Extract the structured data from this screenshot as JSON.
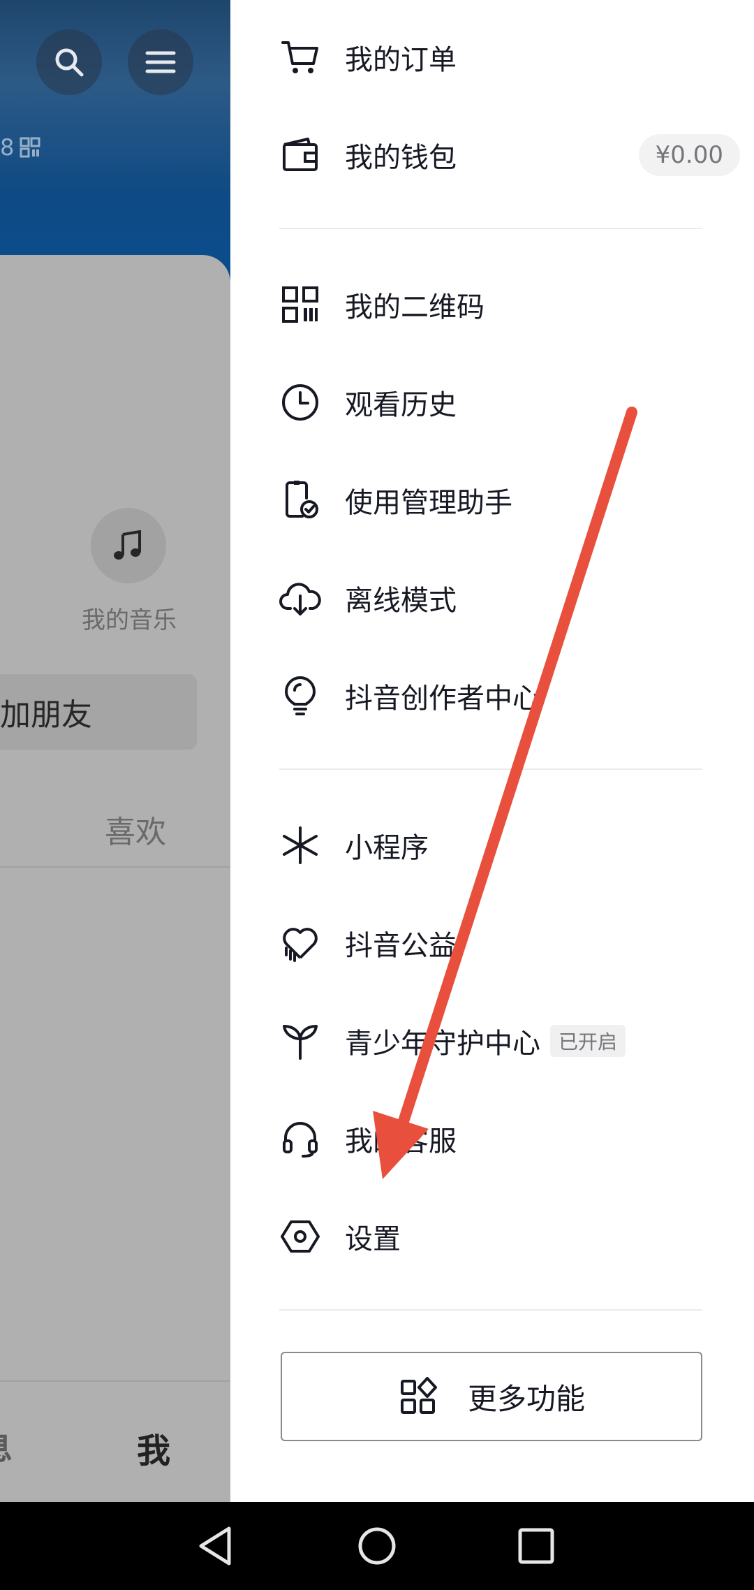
{
  "left_panel": {
    "stats_snippet": "8",
    "music_label": "我的音乐",
    "add_friend_label": "加朋友",
    "like_tab_label": "喜欢",
    "bottom_nav": {
      "messages_label": "息",
      "me_label": "我"
    }
  },
  "drawer": {
    "group1": [
      {
        "icon": "cart-icon",
        "label": "我的订单"
      },
      {
        "icon": "wallet-icon",
        "label": "我的钱包",
        "badge": "¥0.00"
      }
    ],
    "group2": [
      {
        "icon": "qr-code-icon",
        "label": "我的二维码"
      },
      {
        "icon": "clock-icon",
        "label": "观看历史"
      },
      {
        "icon": "phone-check-icon",
        "label": "使用管理助手"
      },
      {
        "icon": "cloud-download-icon",
        "label": "离线模式"
      },
      {
        "icon": "lightbulb-icon",
        "label": "抖音创作者中心"
      }
    ],
    "group3": [
      {
        "icon": "mini-program-icon",
        "label": "小程序"
      },
      {
        "icon": "charity-heart-icon",
        "label": "抖音公益"
      },
      {
        "icon": "sprout-icon",
        "label": "青少年守护中心",
        "tag": "已开启"
      },
      {
        "icon": "headset-icon",
        "label": "我的客服"
      },
      {
        "icon": "hexagon-settings-icon",
        "label": "设置"
      }
    ],
    "more_button_label": "更多功能"
  },
  "colors": {
    "annotation_arrow": "#e8503d",
    "text_primary": "#161823",
    "left_overlay": "#b2b2b2",
    "header_blue": "#0a4d8e"
  }
}
